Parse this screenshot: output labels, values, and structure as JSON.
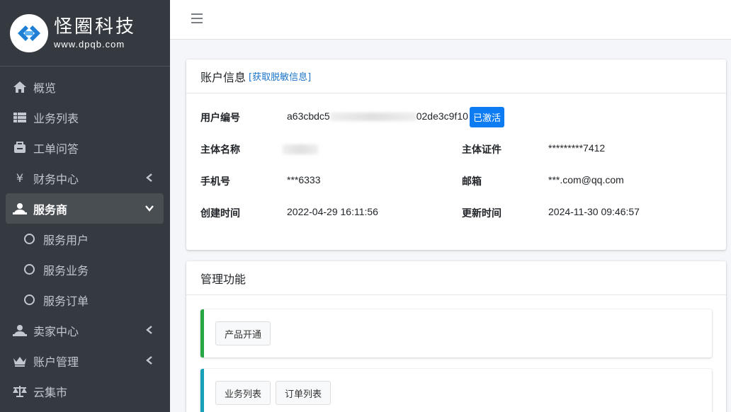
{
  "brand": {
    "name": "怪圈科技",
    "url": "www.dpqb.com"
  },
  "nav": {
    "items": [
      {
        "label": "概览",
        "icon": "home-icon"
      },
      {
        "label": "业务列表",
        "icon": "list-icon"
      },
      {
        "label": "工单问答",
        "icon": "ticket-icon"
      },
      {
        "label": "财务中心",
        "icon": "yen-icon"
      },
      {
        "label": "服务商",
        "icon": "user-tie-icon"
      },
      {
        "label": "服务用户",
        "icon": "circle-icon"
      },
      {
        "label": "服务业务",
        "icon": "circle-icon"
      },
      {
        "label": "服务订单",
        "icon": "circle-icon"
      },
      {
        "label": "卖家中心",
        "icon": "user-tie-icon"
      },
      {
        "label": "账户管理",
        "icon": "crown-icon"
      },
      {
        "label": "云集市",
        "icon": "balance-icon"
      }
    ]
  },
  "account": {
    "title": "账户信息",
    "link": "[获取脱敏信息]",
    "user_id_label": "用户编号",
    "user_id_prefix": "a63cbdc5",
    "user_id_suffix": "02de3c9f10",
    "status": "已激活",
    "subject_name_label": "主体名称",
    "subject_cert_label": "主体证件",
    "subject_cert_value": "*********7412",
    "phone_label": "手机号",
    "phone_value": "***6333",
    "email_label": "邮箱",
    "email_value": "***.com@qq.com",
    "created_label": "创建时间",
    "created_value": "2022-04-29 16:11:56",
    "updated_label": "更新时间",
    "updated_value": "2024-11-30 09:46:57"
  },
  "manage": {
    "title": "管理功能",
    "product_open": "产品开通",
    "business_list": "业务列表",
    "order_list": "订单列表"
  },
  "colors": {
    "sidebar": "#343a40",
    "active": "#494e53",
    "badge": "#0d7cf2",
    "green": "#28a745",
    "teal": "#17a2b8"
  }
}
